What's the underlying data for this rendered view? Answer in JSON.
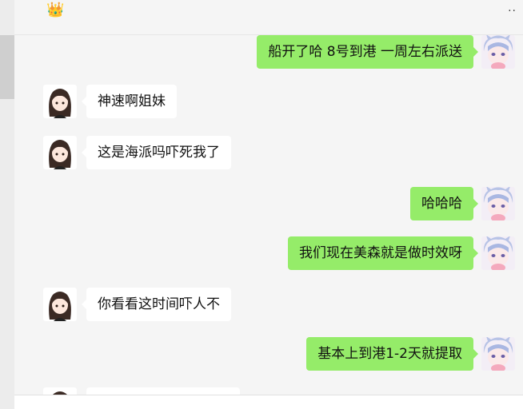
{
  "header": {
    "title_icon": "crown-icon",
    "more_icon": "more-dots-icon",
    "crown_glyph": "👑",
    "more_glyph": "··"
  },
  "messages": [
    {
      "sender": "me",
      "text": "船开了哈 8号到港  一周左右派送"
    },
    {
      "sender": "other",
      "text": "神速啊姐妹"
    },
    {
      "sender": "other",
      "text": "这是海派吗吓死我了"
    },
    {
      "sender": "me",
      "text": "哈哈哈"
    },
    {
      "sender": "me",
      "text": "我们现在美森就是做时效呀"
    },
    {
      "sender": "other",
      "text": "你看看这时间吓人不"
    },
    {
      "sender": "me",
      "text": "基本上到港1-2天就提取"
    },
    {
      "sender": "other",
      "text": ""
    }
  ],
  "colors": {
    "my_bubble": "#95ec69",
    "other_bubble": "#ffffff",
    "background": "#f5f5f5"
  }
}
